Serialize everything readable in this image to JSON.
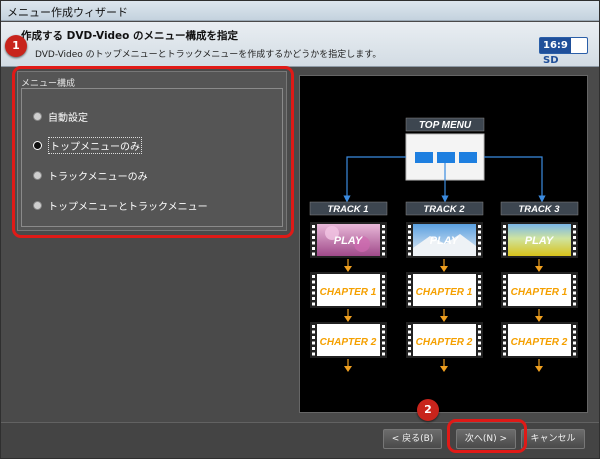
{
  "window": {
    "title": "メニュー作成ウィザード"
  },
  "header": {
    "title": "作成する DVD-Video のメニュー構成を指定",
    "description": "DVD-Video のトップメニューとトラックメニューを作成するかどうかを指定します。",
    "badge_ratio": "16:9",
    "badge_mode": "SD"
  },
  "markers": {
    "one": "1",
    "two": "2"
  },
  "menu_panel": {
    "legend": "メニュー構成",
    "options": [
      {
        "label": "自動設定",
        "selected": false
      },
      {
        "label": "トップメニューのみ",
        "selected": true
      },
      {
        "label": "トラックメニューのみ",
        "selected": false
      },
      {
        "label": "トップメニューとトラックメニュー",
        "selected": false
      }
    ]
  },
  "preview": {
    "top_menu_label": "TOP MENU",
    "tracks": [
      {
        "label": "TRACK 1",
        "play": "PLAY",
        "chapters": [
          "CHAPTER 1",
          "CHAPTER 2"
        ],
        "thumb": "pink-blossom"
      },
      {
        "label": "TRACK 2",
        "play": "PLAY",
        "chapters": [
          "CHAPTER 1",
          "CHAPTER 2"
        ],
        "thumb": "snowy-mountain"
      },
      {
        "label": "TRACK 3",
        "play": "PLAY",
        "chapters": [
          "CHAPTER 1",
          "CHAPTER 2"
        ],
        "thumb": "green-field"
      }
    ],
    "colors": {
      "connector": "#3b8be0",
      "arrow": "#f0a020",
      "chapter_text": "#f5a000",
      "label_bar": "#3d4650"
    }
  },
  "buttons": {
    "back": "< 戻る(B)",
    "next": "次へ(N) >",
    "cancel": "キャンセル"
  },
  "colors": {
    "accent_red": "#e01a17",
    "badge_blue": "#1f4f9a"
  }
}
